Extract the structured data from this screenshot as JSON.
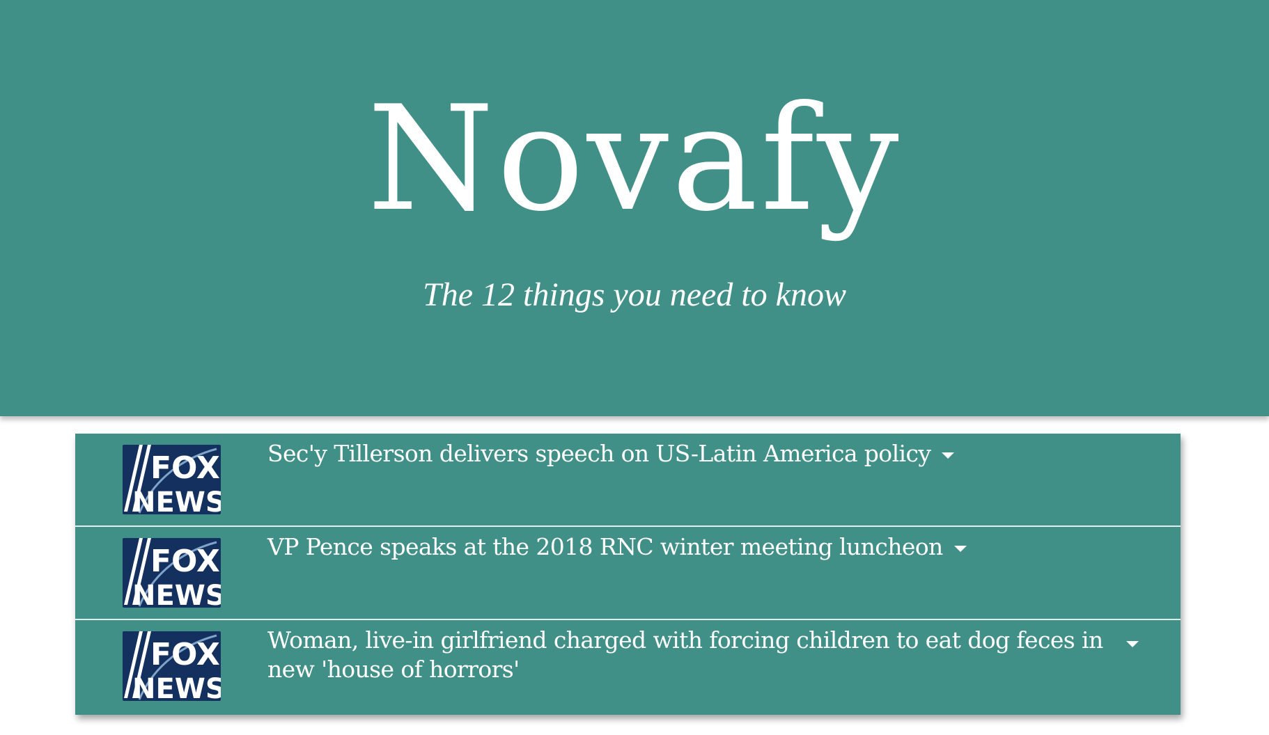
{
  "header": {
    "brand": "Novafy",
    "tagline": "The 12 things you need to know",
    "background": "#419087"
  },
  "feed": {
    "items": [
      {
        "source_logo_top": "FOX",
        "source_logo_bottom": "NEWS",
        "headline": "Sec'y Tillerson delivers speech on US-Latin America policy",
        "toggle_icon": "caret-down-icon"
      },
      {
        "source_logo_top": "FOX",
        "source_logo_bottom": "NEWS",
        "headline": "VP Pence speaks at the 2018 RNC winter meeting luncheon",
        "toggle_icon": "caret-down-icon"
      },
      {
        "source_logo_top": "FOX",
        "source_logo_bottom": "NEWS",
        "headline": "Woman, live-in girlfriend charged with forcing children to eat dog feces in new 'house of horrors'",
        "toggle_icon": "caret-down-icon"
      }
    ],
    "logo_color": "#13305f"
  }
}
